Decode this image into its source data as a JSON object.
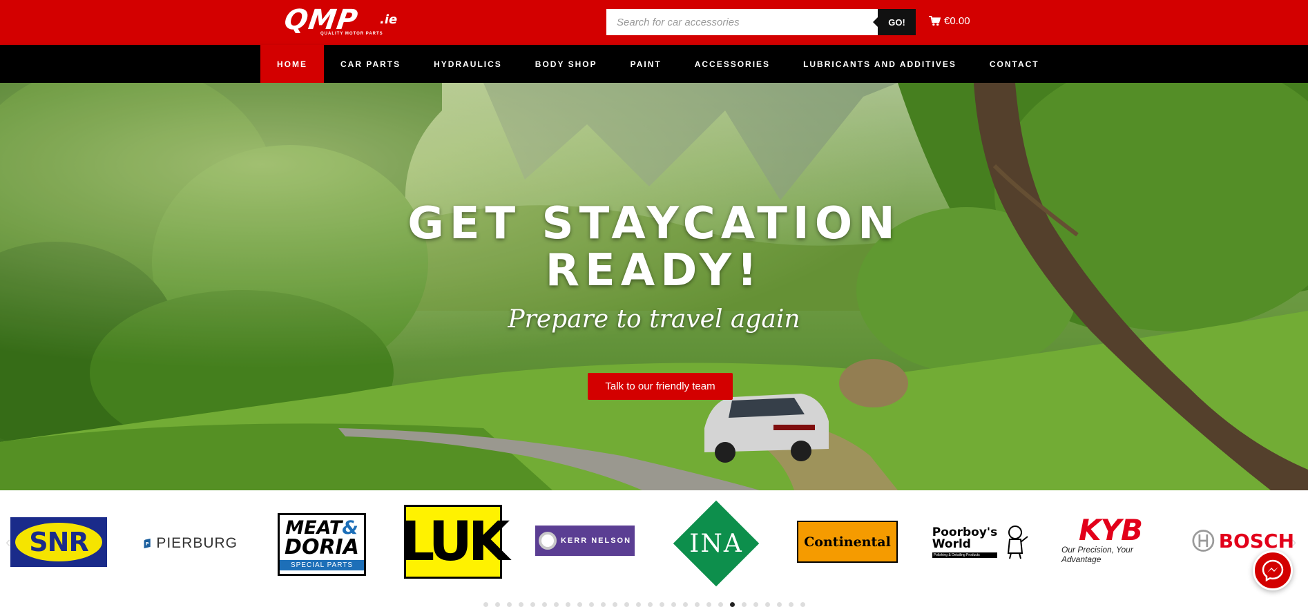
{
  "header": {
    "logo_text": "QMP",
    "logo_suffix": ".ie",
    "logo_tagline": "QUALITY MOTOR PARTS",
    "search_placeholder": "Search for car accessories",
    "search_button": "GO!",
    "cart_total": "€0.00"
  },
  "nav": {
    "items": [
      {
        "label": "HOME",
        "active": true
      },
      {
        "label": "CAR PARTS"
      },
      {
        "label": "HYDRAULICS"
      },
      {
        "label": "BODY SHOP"
      },
      {
        "label": "PAINT"
      },
      {
        "label": "ACCESSORIES"
      },
      {
        "label": "LUBRICANTS AND ADDITIVES"
      },
      {
        "label": "CONTACT"
      }
    ]
  },
  "hero": {
    "title_line1": "GET STAYCATION",
    "title_line2": "READY!",
    "subtitle": "Prepare to travel again",
    "button": "Talk to our friendly team"
  },
  "brands": {
    "items": [
      {
        "name": "SNR"
      },
      {
        "name": "PIERBURG"
      },
      {
        "name": "MEAT & DORIA",
        "line1": "MEAT",
        "amp": "&",
        "line2": "DORIA",
        "tag": "SPECIAL PARTS"
      },
      {
        "name": "LUK"
      },
      {
        "name": "KERR NELSON"
      },
      {
        "name": "INA"
      },
      {
        "name": "Continental"
      },
      {
        "name": "Poorboy's World",
        "line1": "Poorboy's",
        "line2": "World",
        "tag": "Polishing & Detailing Products"
      },
      {
        "name": "KYB",
        "tag": "Our Precision, Your Advantage"
      },
      {
        "name": "BOSCH"
      }
    ],
    "dot_count": 28,
    "active_dot": 21
  },
  "colors": {
    "brand_red": "#d30000",
    "nav_black": "#000000",
    "button_dark": "#111111"
  },
  "icons": [
    "cart-icon",
    "messenger-icon",
    "chevron-left-icon",
    "chevron-right-icon"
  ]
}
